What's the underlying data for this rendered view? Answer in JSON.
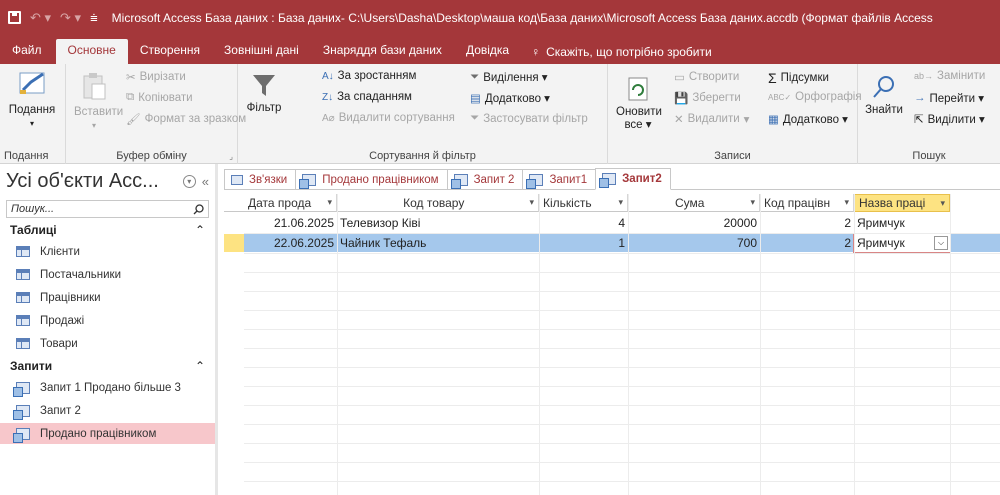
{
  "window": {
    "title": "Microsoft Access База даних : База даних- C:\\Users\\Dasha\\Desktop\\маша код\\База даних\\Microsoft Access База даних.accdb (Формат файлів Access"
  },
  "menu": {
    "tabs": [
      "Файл",
      "Основне",
      "Створення",
      "Зовнішні дані",
      "Знаряддя бази даних",
      "Довідка"
    ],
    "active": "Основне",
    "tell_me": "Скажіть, що потрібно зробити"
  },
  "ribbon": {
    "view": {
      "label": "Подання",
      "group": "Подання"
    },
    "clipboard": {
      "paste": "Вставити",
      "cut": "Вирізати",
      "copy": "Копіювати",
      "format_painter": "Формат за зразком",
      "group": "Буфер обміну"
    },
    "sort_filter": {
      "filter": "Фільтр",
      "ascending": "За зростанням",
      "descending": "За спаданням",
      "remove_sort": "Видалити сортування",
      "selection": "Виділення ▾",
      "advanced": "Додатково ▾",
      "apply_filter": "Застосувати фільтр",
      "group": "Сортування й фільтр"
    },
    "records": {
      "refresh": "Оновити",
      "refresh_sub": "все ▾",
      "new": "Створити",
      "save": "Зберегти",
      "delete": "Видалити",
      "totals": "Підсумки",
      "spelling": "Орфографія",
      "more": "Додатково ▾",
      "group": "Записи"
    },
    "find": {
      "find": "Знайти",
      "replace": "Замінити",
      "goto": "Перейти ▾",
      "select": "Виділити ▾",
      "group": "Пошук"
    }
  },
  "nav": {
    "title": "Усі об'єкти Асс...",
    "search_placeholder": "Пошук...",
    "tables_header": "Таблиці",
    "tables": [
      "Клієнти",
      "Постачальники",
      "Працівники",
      "Продажі",
      "Товари"
    ],
    "queries_header": "Запити",
    "queries": [
      "Запит 1 Продано більше 3",
      "Запит 2",
      "Продано працівником"
    ],
    "selected_query": "Продано працівником"
  },
  "doc_tabs": [
    "Зв'язки",
    "Продано працівником",
    "Запит 2",
    "Запит1",
    "Запит2"
  ],
  "active_doc_tab": "Запит2",
  "datasheet": {
    "columns": [
      "Дата прода",
      "Код товару",
      "Кількість",
      "Сума",
      "Код працівн",
      "Назва праці"
    ],
    "rows": [
      [
        "21.06.2025",
        "Телевизор Ківі",
        "4",
        "20000",
        "2",
        "Яримчук"
      ],
      [
        "22.06.2025",
        "Чайник Тефаль",
        "1",
        "700",
        "2",
        "Яримчук"
      ]
    ],
    "highlight_color": "#fde382",
    "selected_row_color": "#a5c8ec"
  },
  "colors": {
    "accent": "#a4373a"
  }
}
